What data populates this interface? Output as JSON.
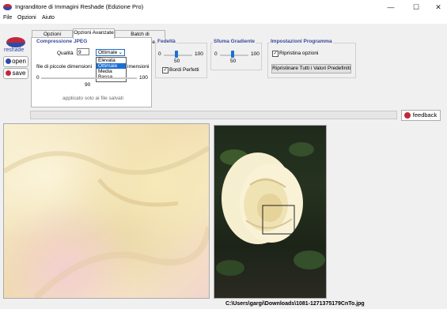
{
  "window": {
    "title": "Ingranditore di Immagini Reshade (Edizione Pro)",
    "controls": [
      "—",
      "☐",
      "✕"
    ]
  },
  "menu": [
    "File",
    "Opzioni",
    "Aiuto"
  ],
  "sidebar": {
    "logo_text": "reshade",
    "open_label": "open",
    "save_label": "save"
  },
  "tabs": [
    "Opzioni Principali",
    "Opzioni Avanzate",
    "Batch di Elaborazione"
  ],
  "jpeg": {
    "title": "Compressione JPEG",
    "quality_label": "Qualità",
    "quality_value": "9",
    "selected": "Ottimale",
    "options": [
      "Elevata",
      "Ottimale",
      "Media",
      "Bassa"
    ],
    "small_files_label": "file di piccole dimensioni",
    "clipped_label": "imensioni",
    "slider_min": "0",
    "slider_max": "100",
    "slider_value": "90",
    "note": "applicato solo ai file salvati"
  },
  "fidelity": {
    "title": "Fedeltà",
    "min": "0",
    "max": "100",
    "value": "50",
    "checkbox_label": "Bordi Perfetti"
  },
  "blur": {
    "title": "Sfuma Gradiente",
    "min": "0",
    "max": "100",
    "value": "50"
  },
  "program": {
    "title": "Impostazioni Programma",
    "restore_label": "Ripristina opzioni",
    "reset_button": "Ripristinare Tutti i Valori Predefiniti"
  },
  "feedback_label": "feedback",
  "status_path": "C:\\Users\\gargi\\Downloads\\1081-1271375179CnTo.jpg",
  "colors": {
    "accent": "#1c6fd1",
    "group_title": "#3a4a9a",
    "logo_red": "#c0283c",
    "logo_blue": "#2d4aa8"
  },
  "icons": {
    "open": "eye-icon",
    "save": "help-circle-icon",
    "feedback": "ladybug-icon"
  }
}
